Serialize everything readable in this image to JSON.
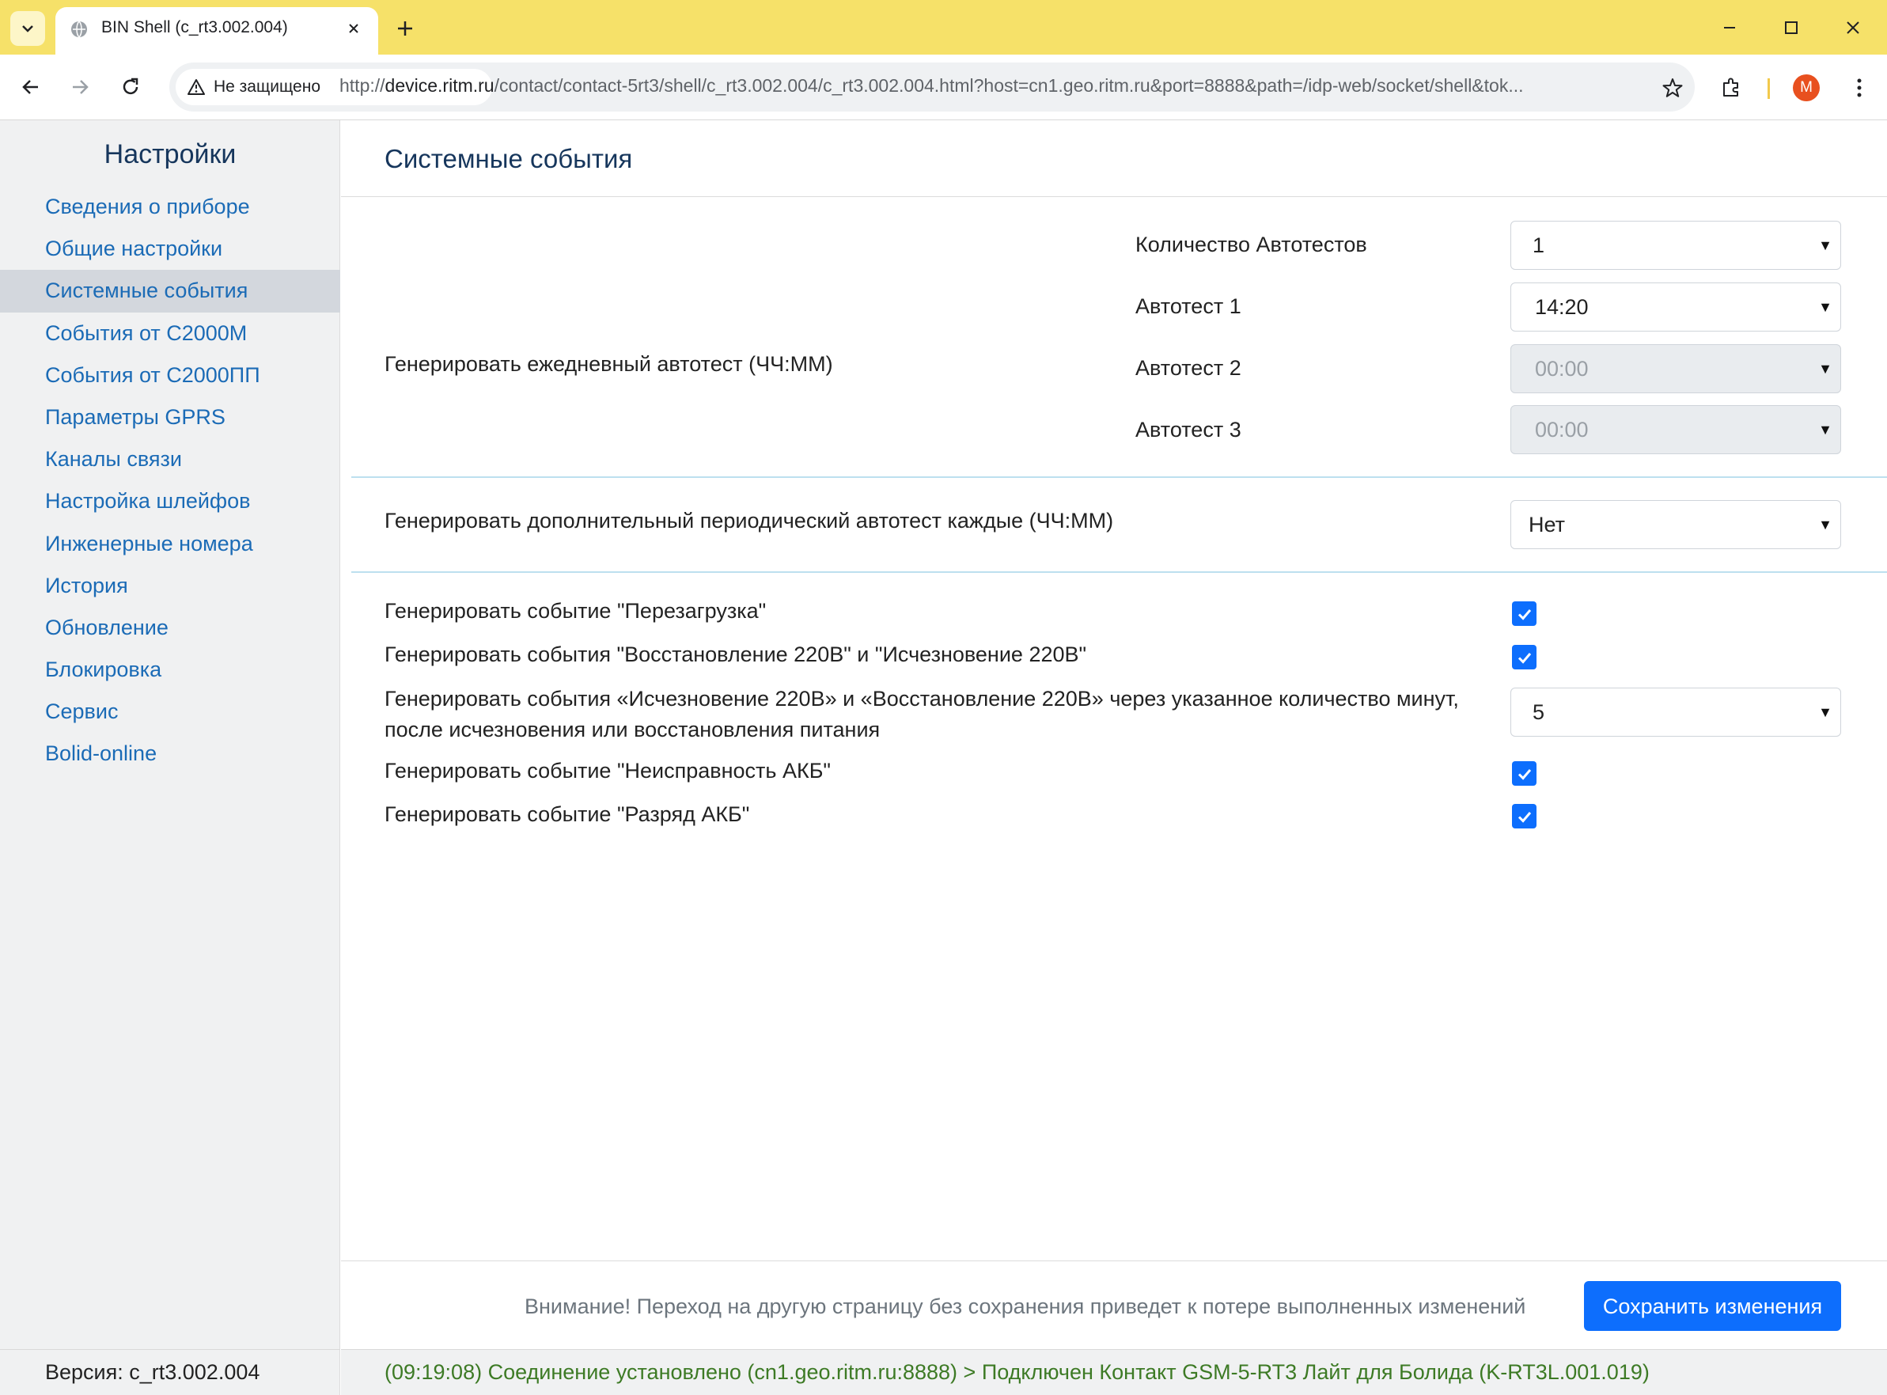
{
  "browser": {
    "tab_title": "BIN Shell (c_rt3.002.004)",
    "security_label": "Не защищено",
    "url_scheme": "http://",
    "url_host": "device.ritm.ru",
    "url_path": "/contact/contact-5rt3/shell/c_rt3.002.004/c_rt3.002.004.html?host=cn1.geo.ritm.ru&port=8888&path=/idp-web/socket/shell&tok...",
    "avatar_letter": "M",
    "colors": {
      "tabbar": "#f6e169",
      "avatar": "#e8501f"
    }
  },
  "sidebar": {
    "title": "Настройки",
    "items": [
      {
        "label": "Сведения о приборе",
        "active": false
      },
      {
        "label": "Общие настройки",
        "active": false
      },
      {
        "label": "Системные события",
        "active": true
      },
      {
        "label": "События от С2000М",
        "active": false
      },
      {
        "label": "События от С2000ПП",
        "active": false
      },
      {
        "label": "Параметры GPRS",
        "active": false
      },
      {
        "label": "Каналы связи",
        "active": false
      },
      {
        "label": "Настройка шлейфов",
        "active": false
      },
      {
        "label": "Инженерные номера",
        "active": false
      },
      {
        "label": "История",
        "active": false
      },
      {
        "label": "Обновление",
        "active": false
      },
      {
        "label": "Блокировка",
        "active": false
      },
      {
        "label": "Сервис",
        "active": false
      },
      {
        "label": "Bolid-online",
        "active": false
      }
    ],
    "version": "Версия: c_rt3.002.004"
  },
  "main": {
    "title": "Системные события",
    "daily_autotest": {
      "label": "Генерировать ежедневный автотест (ЧЧ:ММ)",
      "count_label": "Количество Автотестов",
      "count_value": "1",
      "autotest1_label": "Автотест 1",
      "autotest1_value": "14:20",
      "autotest2_label": "Автотест 2",
      "autotest2_value": "00:00",
      "autotest3_label": "Автотест 3",
      "autotest3_value": "00:00"
    },
    "periodic_autotest": {
      "label": "Генерировать дополнительный периодический автотест каждые (ЧЧ:ММ)",
      "value": "Нет"
    },
    "events": {
      "reboot_label": "Генерировать событие \"Перезагрузка\"",
      "reboot_checked": true,
      "power_label": "Генерировать события \"Восстановление 220В\" и \"Исчезновение 220В\"",
      "power_checked": true,
      "power_delay_label": "Генерировать события «Исчезновение 220В» и «Восстановление 220В» через указанное количество минут, после исчезновения или восстановления питания",
      "power_delay_value": "5",
      "battery_fault_label": "Генерировать событие \"Неисправность АКБ\"",
      "battery_fault_checked": true,
      "battery_low_label": "Генерировать событие \"Разряд АКБ\"",
      "battery_low_checked": true
    },
    "footer": {
      "warning": "Внимание! Переход на другую страницу без сохранения приведет к потере выполненных изменений",
      "save_label": "Сохранить изменения"
    },
    "status": "(09:19:08) Соединение установлено (cn1.geo.ritm.ru:8888) > Подключен Контакт GSM-5-RT3 Лайт для Болида (K-RT3L.001.019)"
  },
  "colors": {
    "accent": "#0d6efd",
    "link": "#1b6bb6",
    "title": "#16365c",
    "status_ok": "#3d7a25",
    "divider": "#bde0ef"
  }
}
